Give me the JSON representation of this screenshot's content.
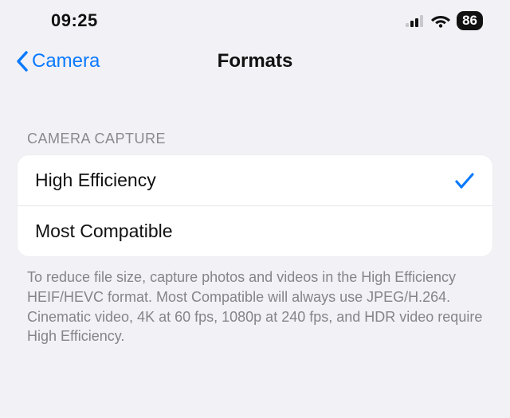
{
  "status": {
    "time": "09:25",
    "battery": "86"
  },
  "nav": {
    "back_label": "Camera",
    "title": "Formats"
  },
  "section": {
    "header": "CAMERA CAPTURE",
    "options": [
      {
        "label": "High Efficiency",
        "selected": true
      },
      {
        "label": "Most Compatible",
        "selected": false
      }
    ],
    "footer": "To reduce file size, capture photos and videos in the High Efficiency HEIF/HEVC format. Most Compatible will always use JPEG/H.264. Cinematic video, 4K at 60 fps, 1080p at 240 fps, and HDR video require High Efficiency."
  }
}
